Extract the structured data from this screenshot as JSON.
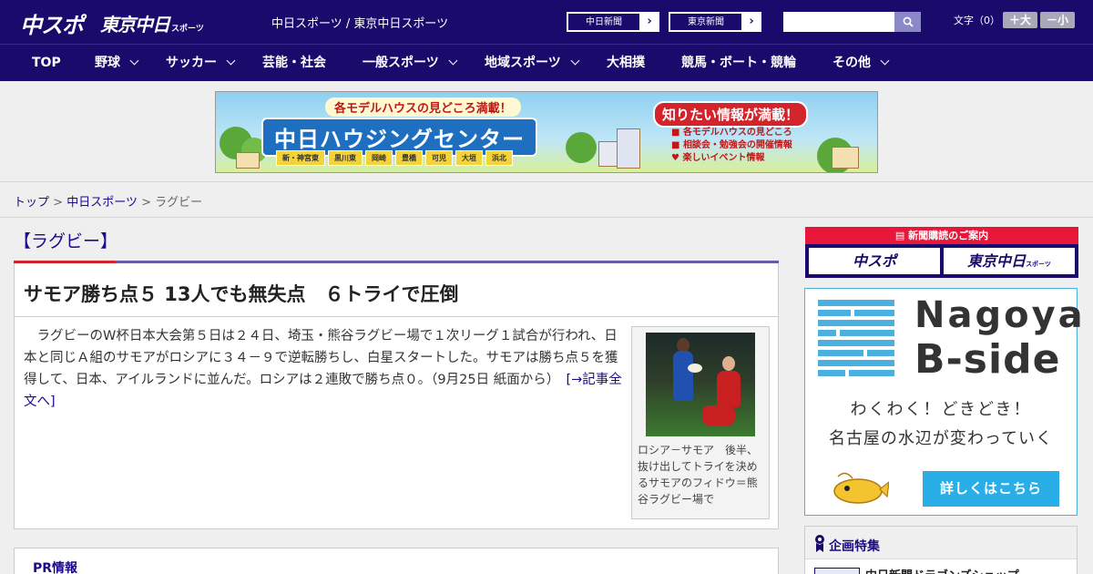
{
  "header": {
    "logo_main": "中スポ",
    "logo_tokyo": "東京中日",
    "logo_tokyo_small": "スポーツ",
    "site_name": "中日スポーツ / 東京中日スポーツ",
    "links": [
      {
        "label": "中日新聞"
      },
      {
        "label": "東京新聞"
      }
    ],
    "search": {
      "value": "",
      "placeholder": ""
    },
    "font_size": {
      "label": "文字（0）",
      "increase": "＋大",
      "decrease": "－小"
    }
  },
  "nav": {
    "items": [
      {
        "label": "TOP",
        "has_menu": false
      },
      {
        "label": "野球",
        "has_menu": true
      },
      {
        "label": "サッカー",
        "has_menu": true
      },
      {
        "label": "芸能・社会",
        "has_menu": false
      },
      {
        "label": "一般スポーツ",
        "has_menu": true
      },
      {
        "label": "地域スポーツ",
        "has_menu": true
      },
      {
        "label": "大相撲",
        "has_menu": false
      },
      {
        "label": "競馬・ボート・競輪",
        "has_menu": false
      },
      {
        "label": "その他",
        "has_menu": true
      }
    ]
  },
  "ad_banner": {
    "top_text": "各モデルハウスの見どころ満載！",
    "title": "中日ハウジングセンター",
    "locations": [
      "新・神宮東",
      "黒川東",
      "岡崎",
      "豊橋",
      "可児",
      "大垣",
      "浜北"
    ],
    "catch": "知りたい情報が満載！",
    "bullets": [
      "各モデルハウスの見どころ",
      "相談会・勉強会の開催情報",
      "楽しいイベント情報"
    ]
  },
  "breadcrumb": {
    "items": [
      {
        "label": "トップ",
        "link": true
      },
      {
        "label": "中日スポーツ",
        "link": true
      },
      {
        "label": "ラグビー",
        "link": false
      }
    ],
    "separator": ">"
  },
  "article": {
    "category": "【ラグビー】",
    "headline": "サモア勝ち点５ 13人でも無失点　６トライで圧倒",
    "body": "　ラグビーのW杯日本大会第５日は２４日、埼玉・熊谷ラグビー場で１次リーグ１試合が行われ、日本と同じＡ組のサモアがロシアに３４－９で逆転勝ちし、白星スタートした。サモアは勝ち点５を獲得して、日本、アイルランドに並んだ。ロシアは２連敗で勝ち点０。（9月25日 紙面から）　",
    "full_link": "[→記事全文へ]",
    "photo_caption": "ロシア－サモア　後半、抜け出してトライを決めるサモアのフィドウ＝熊谷ラグビー場で"
  },
  "pr": {
    "label": "PR情報"
  },
  "sidebar": {
    "subscribe": {
      "head": "新聞購読のご案内",
      "logo1": "中スポ",
      "logo2": "東京中日",
      "logo2_small": "スポーツ"
    },
    "bside": {
      "title1": "Nagoya",
      "title2": "B-side",
      "copy1": "わくわく！どきどき！",
      "copy2": "名古屋の水辺が変わっていく",
      "button": "詳しくはこちら"
    },
    "feature": {
      "title": "企画特集",
      "item": "中日新聞ドラゴンズショップ"
    }
  },
  "colors": {
    "navy": "#1a0a6b",
    "accent_red": "#d2242a",
    "link": "#1a0a8b",
    "bside_blue": "#2aaee8"
  }
}
